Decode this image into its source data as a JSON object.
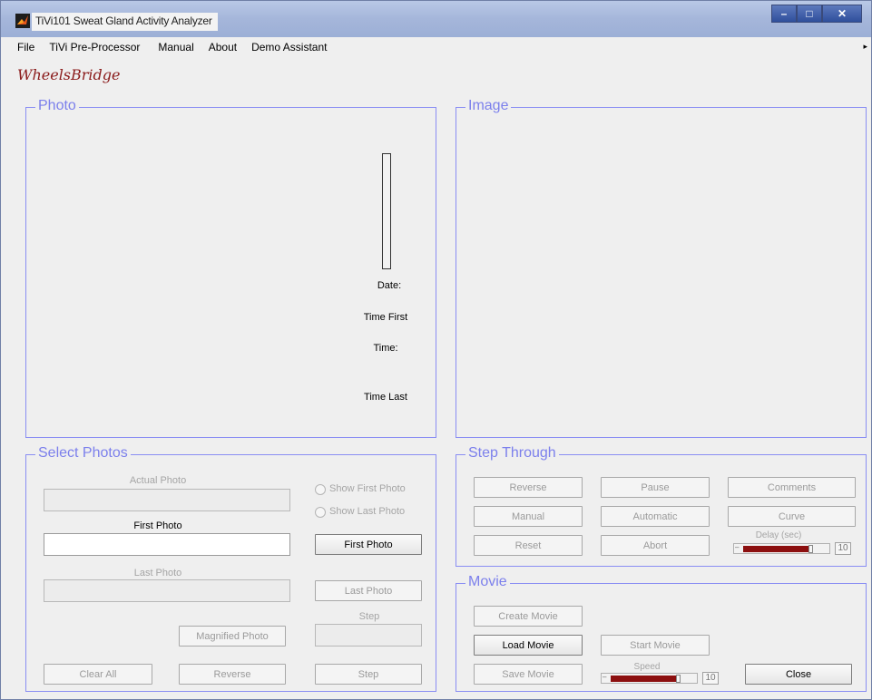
{
  "window": {
    "title": "TiVi101 Sweat Gland Activity Analyzer",
    "controls": [
      "minimize",
      "maximize",
      "close"
    ]
  },
  "menu": {
    "items": [
      "File",
      "TiVi Pre-Processor",
      "Manual",
      "About",
      "Demo Assistant"
    ]
  },
  "logo": {
    "text": "WheelsBridge"
  },
  "photo_panel": {
    "title": "Photo",
    "date_label": "Date:",
    "time_first_label": "Time First",
    "time_label": "Time:",
    "time_last_label": "Time Last"
  },
  "image_panel": {
    "title": "Image"
  },
  "select_photos": {
    "title": "Select Photos",
    "actual_photo_label": "Actual Photo",
    "first_photo_label": "First Photo",
    "last_photo_label": "Last Photo",
    "step_label": "Step",
    "show_first_photo": "Show First Photo",
    "show_last_photo": "Show Last Photo",
    "first_photo_button": "First Photo",
    "last_photo_button": "Last Photo",
    "magnified_photo_button": "Magnified Photo",
    "clear_all_button": "Clear All",
    "reverse_button": "Reverse",
    "step_button": "Step"
  },
  "step_through": {
    "title": "Step Through",
    "reverse": "Reverse",
    "pause": "Pause",
    "comments": "Comments",
    "manual": "Manual",
    "automatic": "Automatic",
    "curve": "Curve",
    "reset": "Reset",
    "abort": "Abort",
    "delay_label": "Delay (sec)",
    "delay_value": "10",
    "delay_level": 0.85
  },
  "movie": {
    "title": "Movie",
    "create_movie": "Create Movie",
    "load_movie": "Load Movie",
    "start_movie": "Start Movie",
    "save_movie": "Save Movie",
    "speed_label": "Speed",
    "speed_value": "10",
    "speed_level": 0.85,
    "close": "Close"
  }
}
